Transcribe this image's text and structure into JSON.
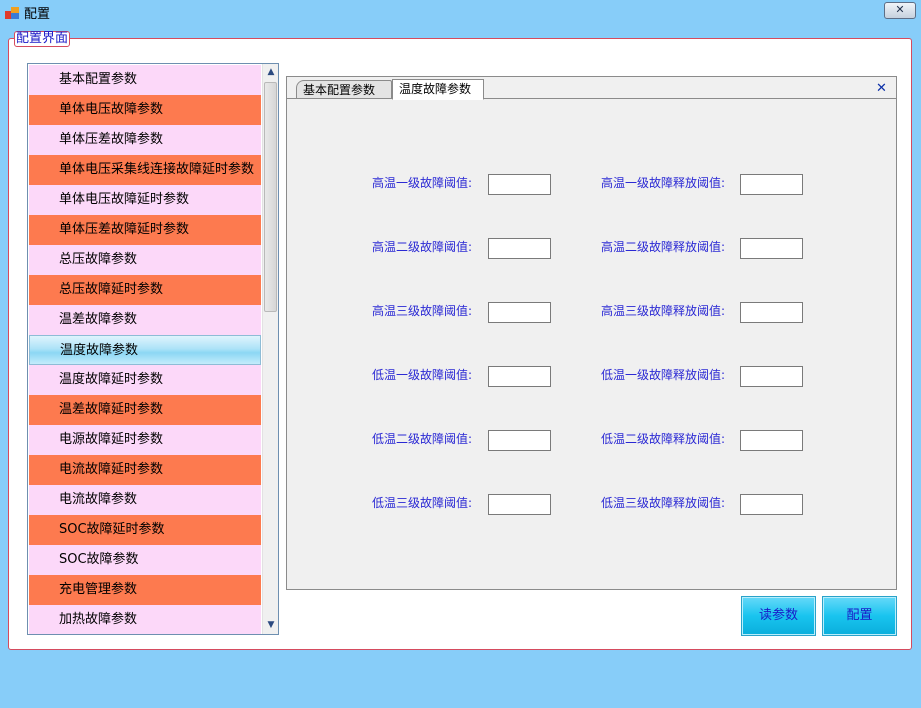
{
  "window": {
    "title": "配置",
    "close_symbol": "✕"
  },
  "group": {
    "label": "配置界面"
  },
  "list": {
    "items": [
      {
        "label": "基本配置参数",
        "style": "pink"
      },
      {
        "label": "单体电压故障参数",
        "style": "orange"
      },
      {
        "label": "单体压差故障参数",
        "style": "pink"
      },
      {
        "label": "单体电压采集线连接故障延时参数",
        "style": "orange"
      },
      {
        "label": "单体电压故障延时参数",
        "style": "pink"
      },
      {
        "label": "单体压差故障延时参数",
        "style": "orange"
      },
      {
        "label": "总压故障参数",
        "style": "pink"
      },
      {
        "label": "总压故障延时参数",
        "style": "orange"
      },
      {
        "label": "温差故障参数",
        "style": "pink"
      },
      {
        "label": "温度故障参数",
        "style": "selected"
      },
      {
        "label": "温度故障延时参数",
        "style": "pink"
      },
      {
        "label": "温差故障延时参数",
        "style": "orange"
      },
      {
        "label": "电源故障延时参数",
        "style": "pink"
      },
      {
        "label": "电流故障延时参数",
        "style": "orange"
      },
      {
        "label": "电流故障参数",
        "style": "pink"
      },
      {
        "label": "SOC故障延时参数",
        "style": "orange"
      },
      {
        "label": "SOC故障参数",
        "style": "pink"
      },
      {
        "label": "充电管理参数",
        "style": "orange"
      },
      {
        "label": "加热故障参数",
        "style": "pink"
      }
    ],
    "scroll_up_symbol": "▲",
    "scroll_down_symbol": "▼"
  },
  "tabs": {
    "items": [
      {
        "label": "基本配置参数",
        "active": false
      },
      {
        "label": "温度故障参数",
        "active": true
      }
    ],
    "close_symbol": "✕"
  },
  "form": {
    "rows": [
      {
        "left_label": "高温一级故障阈值:",
        "left_value": "",
        "right_label": "高温一级故障释放阈值:",
        "right_value": ""
      },
      {
        "left_label": "高温二级故障阈值:",
        "left_value": "",
        "right_label": "高温二级故障释放阈值:",
        "right_value": ""
      },
      {
        "left_label": "高温三级故障阈值:",
        "left_value": "",
        "right_label": "高温三级故障释放阈值:",
        "right_value": ""
      },
      {
        "left_label": "低温一级故障阈值:",
        "left_value": "",
        "right_label": "低温一级故障释放阈值:",
        "right_value": ""
      },
      {
        "left_label": "低温二级故障阈值:",
        "left_value": "",
        "right_label": "低温二级故障释放阈值:",
        "right_value": ""
      },
      {
        "left_label": "低温三级故障阈值:",
        "left_value": "",
        "right_label": "低温三级故障释放阈值:",
        "right_value": ""
      }
    ]
  },
  "buttons": {
    "read_label": "读参数",
    "config_label": "配置"
  },
  "colors": {
    "background": "#87cdf9",
    "list_pink": "#fcd8f9",
    "list_orange": "#fd7a4f",
    "label_blue": "#2a28d4",
    "button_cyan": "#19c4ef",
    "group_border": "#d54b5e"
  }
}
